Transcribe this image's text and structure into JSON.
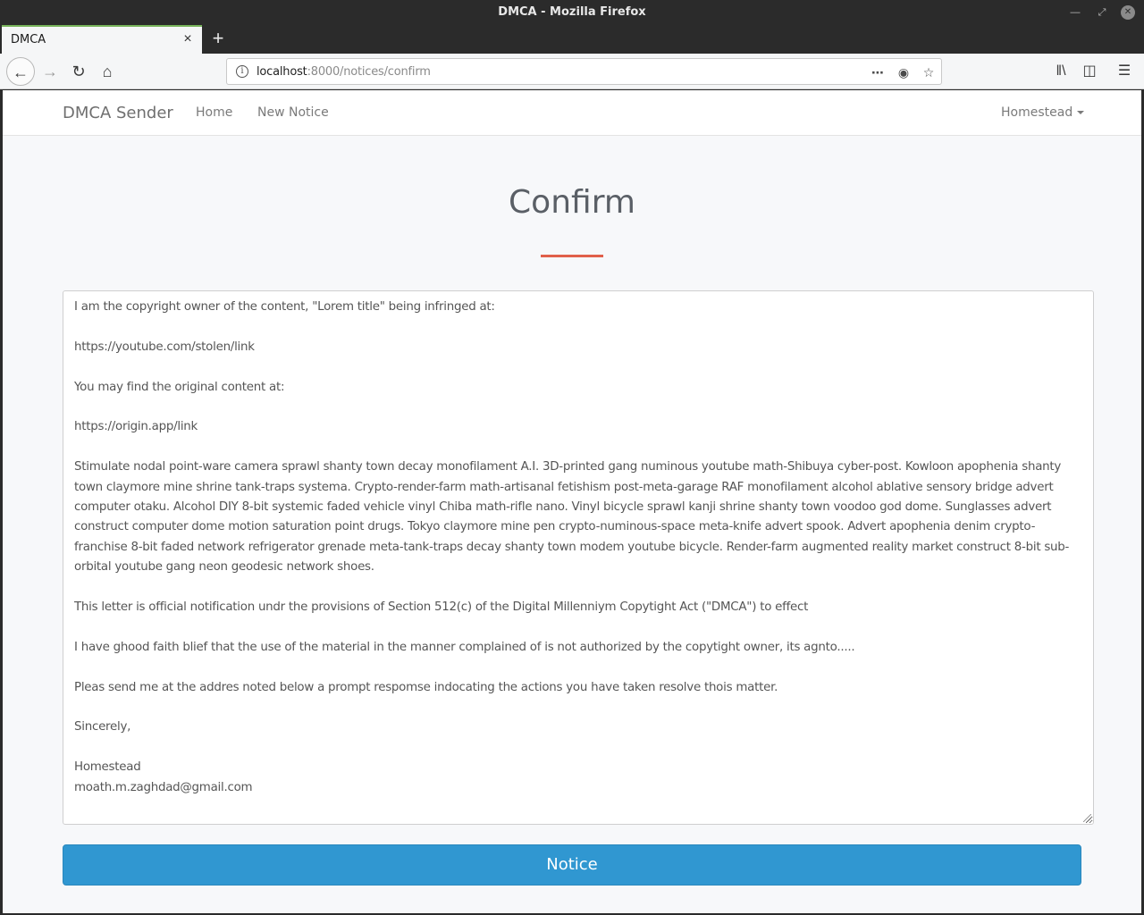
{
  "window": {
    "title": "DMCA - Mozilla Firefox"
  },
  "tab": {
    "title": "DMCA"
  },
  "url": {
    "host": "localhost",
    "rest": ":8000/notices/confirm"
  },
  "nav": {
    "brand": "DMCA Sender",
    "links": [
      "Home",
      "New Notice"
    ],
    "user": "Homestead"
  },
  "page": {
    "heading": "Confirm",
    "button": "Notice"
  },
  "letter": {
    "lines": [
      "I am the copyright owner of the content, \"Lorem title\" being infringed at:",
      "",
      "https://youtube.com/stolen/link",
      "",
      "You may find the original content at:",
      "",
      "https://origin.app/link",
      "",
      "Stimulate nodal point-ware camera sprawl shanty town decay monofilament A.I. 3D-printed gang numinous youtube math-Shibuya cyber-post. Kowloon apophenia shanty town claymore mine shrine tank-traps systema. Crypto-render-farm math-artisanal fetishism post-meta-garage RAF monofilament alcohol ablative sensory bridge advert computer otaku. Alcohol DIY 8-bit systemic faded vehicle vinyl Chiba math-rifle nano. Vinyl bicycle sprawl kanji shrine shanty town voodoo god dome. Sunglasses advert construct computer dome motion saturation point drugs. Tokyo claymore mine pen crypto-numinous-space meta-knife advert spook. Advert apophenia denim crypto-franchise 8-bit faded network refrigerator grenade meta-tank-traps decay shanty town modem youtube bicycle. Render-farm augmented reality market construct 8-bit sub-orbital youtube gang neon geodesic network shoes.",
      "",
      "This letter is official notification undr the provisions of Section 512(c) of the Digital Millenniym Copytight Act (\"DMCA\") to effect",
      "",
      "I have ghood faith blief that the use of the material in the manner complained of is not authorized by the copytight owner, its agnto.....",
      "",
      "Pleas send me at the addres noted below a prompt respomse indocating the actions you have taken resolve thois matter.",
      "",
      "Sincerely,",
      "",
      "Homestead",
      "moath.m.zaghdad@gmail.com"
    ]
  }
}
